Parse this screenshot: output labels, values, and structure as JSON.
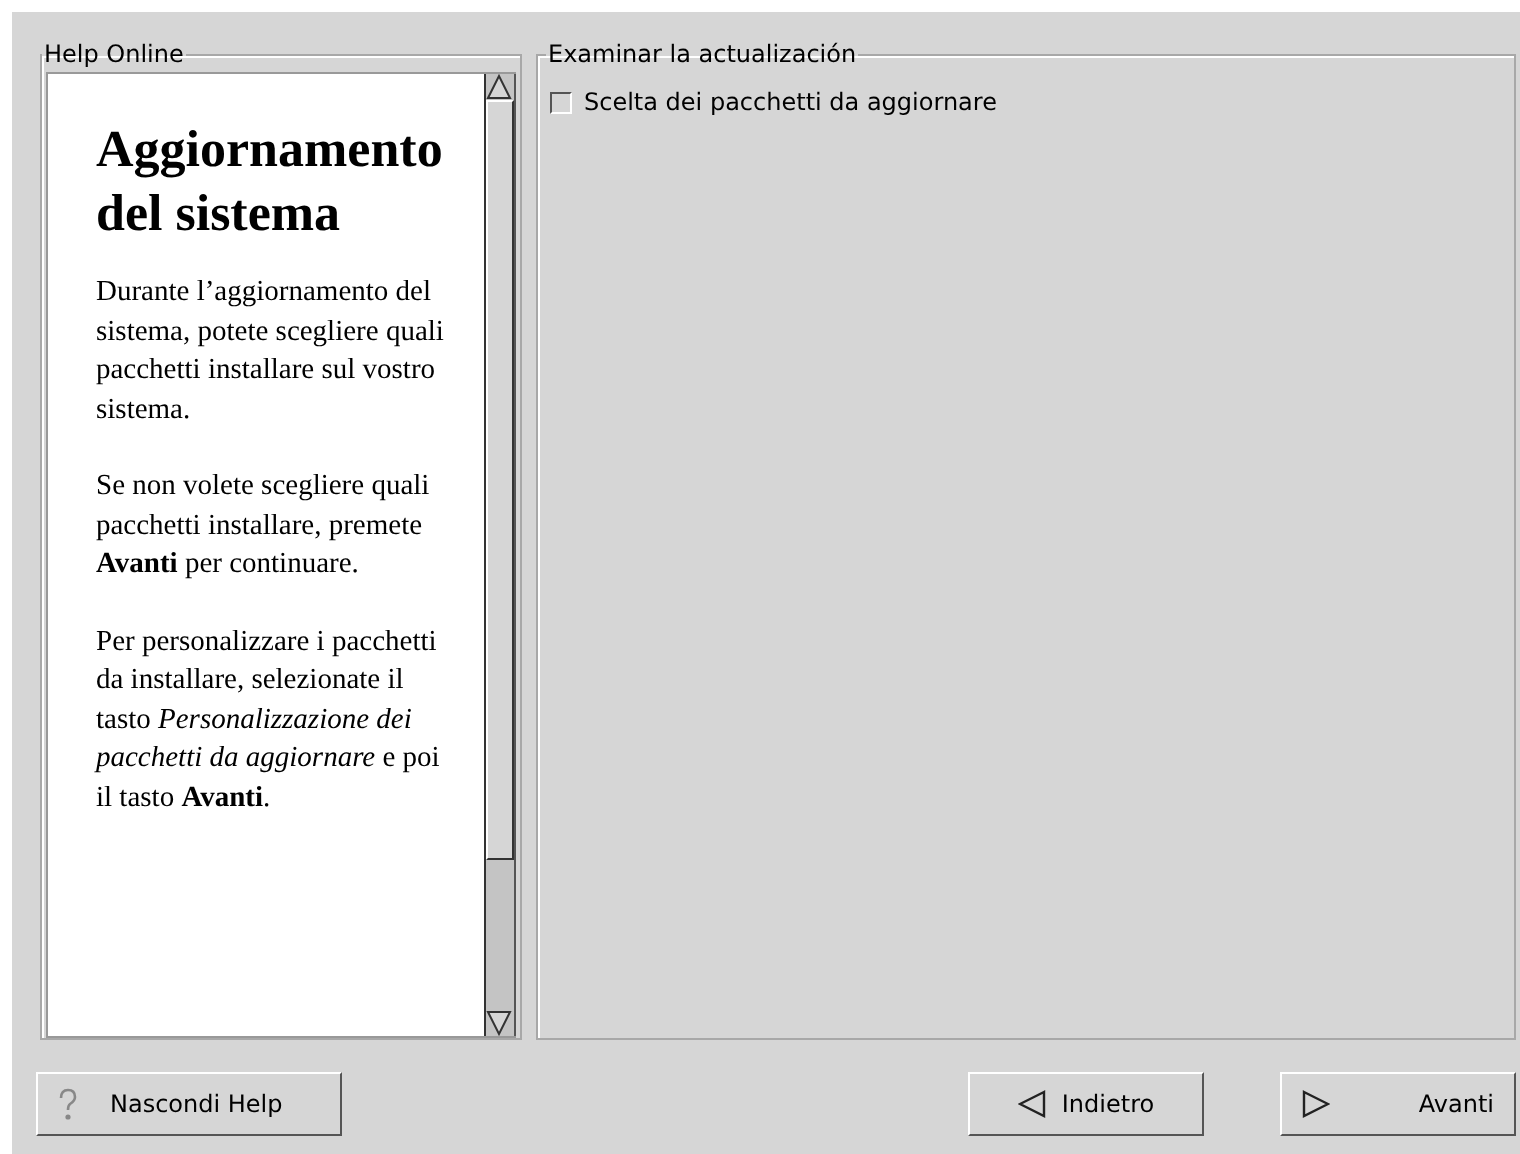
{
  "help": {
    "title": "Help Online",
    "heading": "Aggiornamento del sistema",
    "paragraphs": [
      "Durante l’aggiornamento del sistema, potete scegliere quali pacchetti installare sul vostro sistema.",
      "Se non volete scegliere quali pacchetti installare, premete **Avanti** per continuare.",
      "Per personalizzare i pacchetti da installare, selezionate il tasto *Personalizzazione dei pacchetti da aggiornare* e poi il tasto **Avanti**."
    ]
  },
  "review": {
    "title": "Examinar la actualización",
    "option": {
      "label": "Scelta dei pacchetti da aggiornare",
      "checked": false
    }
  },
  "buttons": [
    {
      "label": "Nascondi Help",
      "kind": "help"
    },
    {
      "label": "Indietro",
      "kind": "back"
    },
    {
      "label": "Avanti",
      "kind": "next"
    }
  ]
}
